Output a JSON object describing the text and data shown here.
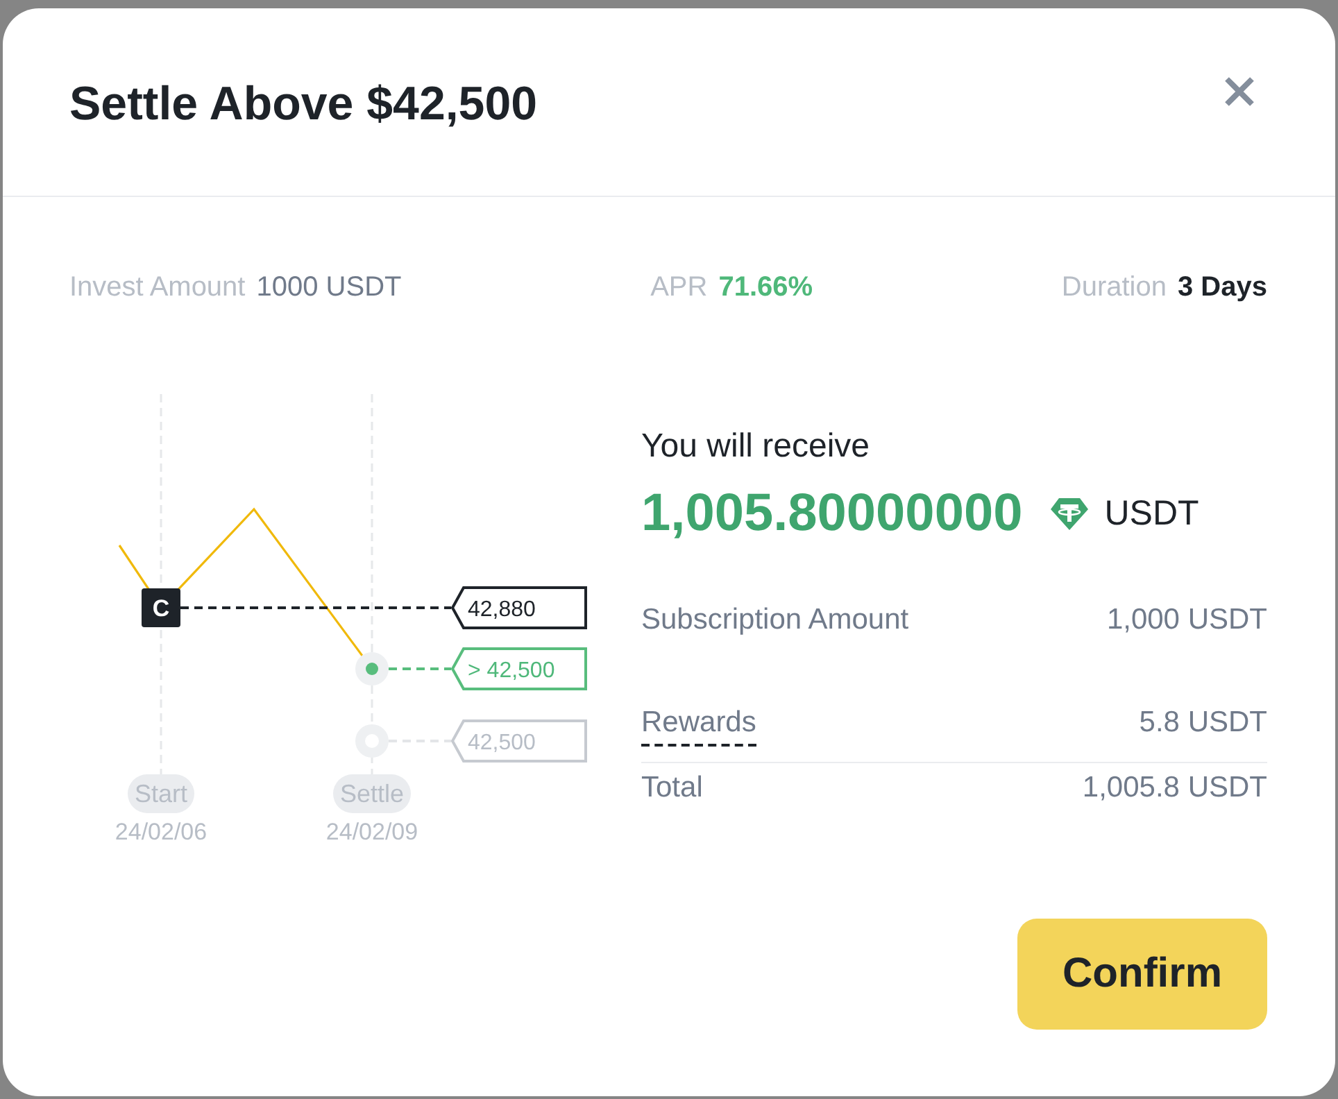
{
  "dialog": {
    "title": "Settle Above $42,500"
  },
  "stats": [
    {
      "label": "Invest Amount",
      "value": "1000 USDT",
      "kind": "plain"
    },
    {
      "label": "APR",
      "value": "71.66%",
      "kind": "positive"
    },
    {
      "label": "Duration",
      "value": "3 Days",
      "kind": "strong"
    }
  ],
  "chart": {
    "levels": [
      {
        "kind": "current",
        "marker": "C",
        "tag": "42,880"
      },
      {
        "kind": "target",
        "tag": "> 42,500"
      },
      {
        "kind": "strike",
        "tag": "42,500"
      }
    ],
    "dates": [
      {
        "label": "Start",
        "date": "24/02/06"
      },
      {
        "label": "Settle",
        "date": "24/02/09"
      }
    ]
  },
  "receive": {
    "heading": "You will receive",
    "amount": "1,005.80000000",
    "currency": "USDT"
  },
  "summary": [
    {
      "kind": "item",
      "label": "Subscription Amount",
      "value": "1,000 USDT",
      "underlined": false
    },
    {
      "kind": "item",
      "label": "Rewards",
      "value": "5.8 USDT",
      "underlined": true
    },
    {
      "kind": "total",
      "label": "Total",
      "value": "1,005.8 USDT",
      "underlined": false
    }
  ],
  "confirm_button": "Confirm"
}
